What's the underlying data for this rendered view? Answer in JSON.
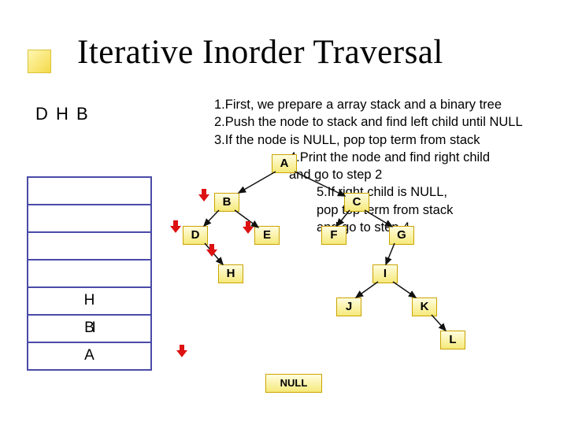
{
  "title": "Iterative Inorder Traversal",
  "output": "D H B",
  "steps": {
    "s1": "1.First, we prepare a array stack and a binary tree",
    "s2": "2.Push the node to stack and find left child until NULL",
    "s3": "3.If the node is NULL, pop top term from stack",
    "s4a": "4.Print the node and find right child",
    "s4b": "and go to step 2",
    "s5a": "5.If right child is NULL,",
    "s5b": "pop top term from stack",
    "s5c": "and go to step 4"
  },
  "stack": {
    "r0": "",
    "r1": "",
    "r2": "",
    "r3": "",
    "r4": "H",
    "r5": "B",
    "r6": "A"
  },
  "stack_overlay": "I",
  "tree": {
    "A": "A",
    "B": "B",
    "C": "C",
    "D": "D",
    "E": "E",
    "F": "F",
    "G": "G",
    "H": "H",
    "I": "I",
    "J": "J",
    "K": "K",
    "L": "L",
    "NULL": "NULL"
  }
}
